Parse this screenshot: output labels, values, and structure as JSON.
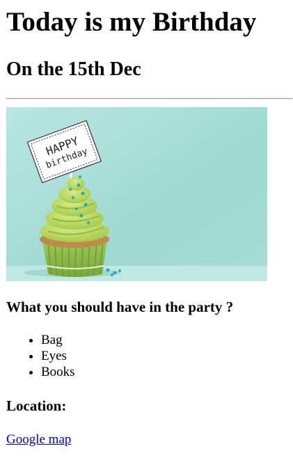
{
  "title": "Today is my Birthday",
  "subtitle": "On the 15th Dec",
  "image": {
    "sign_line1": "HAPPY",
    "sign_line2": "birthday",
    "colors": {
      "background": "#a9ded8",
      "frosting": "#b5d65a",
      "wrapper": "#8bbf4a",
      "sprinkles": "#2aa6c9"
    }
  },
  "party": {
    "heading": "What you should have in the party ?",
    "items": [
      "Bag",
      "Eyes",
      "Books"
    ]
  },
  "location": {
    "heading": "Location:",
    "link_text": "Google map"
  }
}
